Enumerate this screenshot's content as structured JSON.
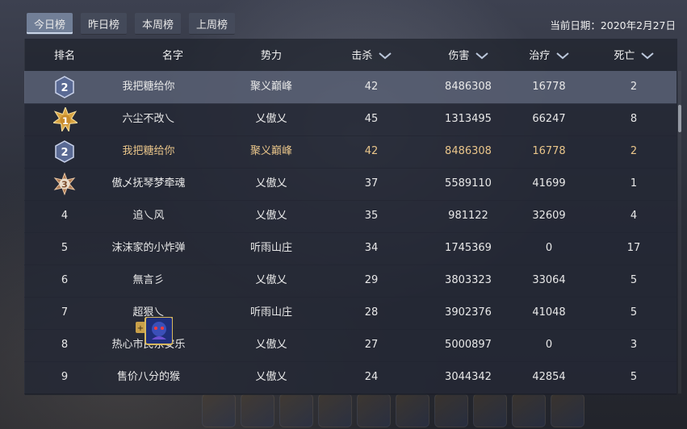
{
  "tabs": [
    "今日榜",
    "昨日榜",
    "本周榜",
    "上周榜"
  ],
  "current_date": "当前日期：2020年2月27日",
  "headers": {
    "rank": "排名",
    "name": "名字",
    "faction": "势力",
    "kills": "击杀",
    "damage": "伤害",
    "healing": "治疗",
    "deaths": "死亡"
  },
  "my_row": {
    "rank": "2",
    "name": "我把糖给你",
    "faction": "聚义巅峰",
    "kills": "42",
    "damage": "8486308",
    "healing": "16778",
    "deaths": "2"
  },
  "rows": [
    {
      "rank": "1",
      "name": "六尘不改乀",
      "faction": "乂傲乂",
      "kills": "45",
      "damage": "1313495",
      "healing": "66247",
      "deaths": "8"
    },
    {
      "rank": "2",
      "name": "我把糖给你",
      "faction": "聚义巅峰",
      "kills": "42",
      "damage": "8486308",
      "healing": "16778",
      "deaths": "2"
    },
    {
      "rank": "3",
      "name": "傲乄抚琴梦牵魂",
      "faction": "乂傲乂",
      "kills": "37",
      "damage": "5589110",
      "healing": "41699",
      "deaths": "1"
    },
    {
      "rank": "4",
      "name": "追乀风",
      "faction": "乂傲乂",
      "kills": "35",
      "damage": "981122",
      "healing": "32609",
      "deaths": "4"
    },
    {
      "rank": "5",
      "name": "沫沫家的小炸弹",
      "faction": "听雨山庄",
      "kills": "34",
      "damage": "1745369",
      "healing": "0",
      "deaths": "17"
    },
    {
      "rank": "6",
      "name": "無言彡",
      "faction": "乂傲乂",
      "kills": "29",
      "damage": "3803323",
      "healing": "33064",
      "deaths": "5"
    },
    {
      "rank": "7",
      "name": "超狠乀",
      "faction": "听雨山庄",
      "kills": "28",
      "damage": "3902376",
      "healing": "41048",
      "deaths": "5"
    },
    {
      "rank": "8",
      "name": "热心市民东安乐",
      "faction": "乂傲乂",
      "kills": "27",
      "damage": "5000897",
      "healing": "0",
      "deaths": "3"
    },
    {
      "rank": "9",
      "name": "售价八分的猴",
      "faction": "乂傲乂",
      "kills": "24",
      "damage": "3044342",
      "healing": "42854",
      "deaths": "5"
    }
  ],
  "colors": {
    "highlight": "#e9c58a",
    "gold_badge": "#d9a441",
    "silver_badge": "#7d8db2"
  }
}
